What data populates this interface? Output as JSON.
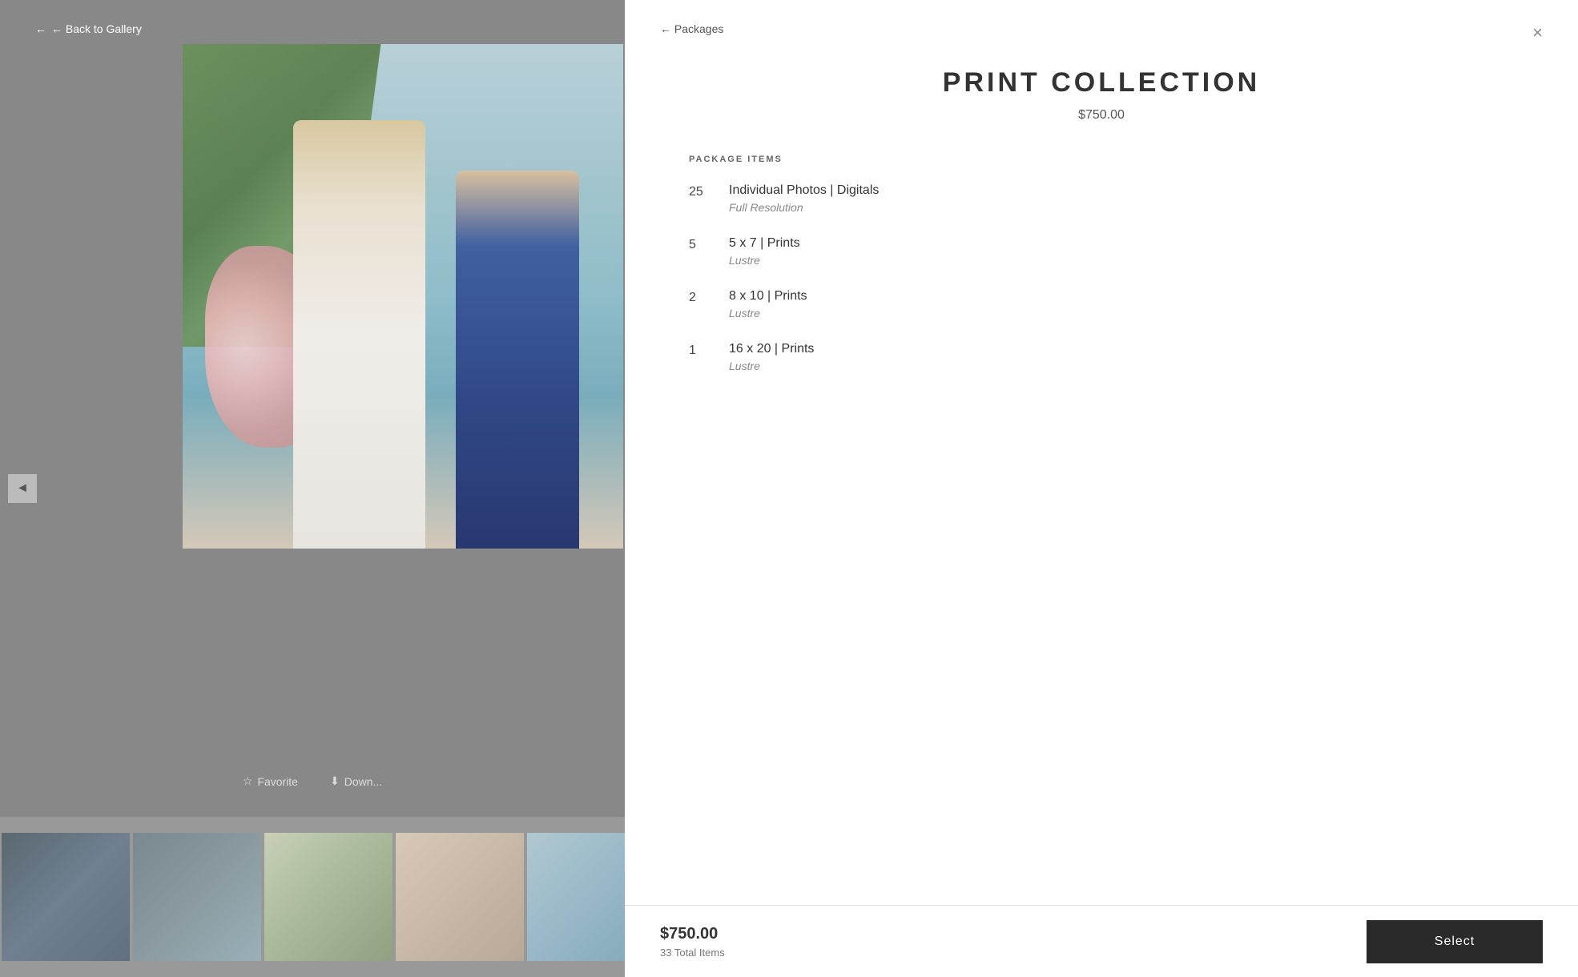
{
  "gallery": {
    "back_label": "← Back to Gallery",
    "prev_icon": "◄",
    "favorite_label": "Favorite",
    "download_label": "Down...",
    "favorite_icon": "☆",
    "download_icon": "⬇"
  },
  "panel": {
    "back_label": "← Packages",
    "close_icon": "×",
    "title": "PRINT COLLECTION",
    "price": "$750.00",
    "items_section_label": "PACKAGE ITEMS",
    "items": [
      {
        "qty": "25",
        "name": "Individual Photos | Digitals",
        "sub": "Full Resolution"
      },
      {
        "qty": "5",
        "name": "5 x 7 | Prints",
        "sub": "Lustre"
      },
      {
        "qty": "2",
        "name": "8 x 10 | Prints",
        "sub": "Lustre"
      },
      {
        "qty": "1",
        "name": "16 x 20 | Prints",
        "sub": "Lustre"
      }
    ],
    "footer": {
      "price": "$750.00",
      "total_items": "33 Total Items",
      "select_label": "Select"
    }
  }
}
